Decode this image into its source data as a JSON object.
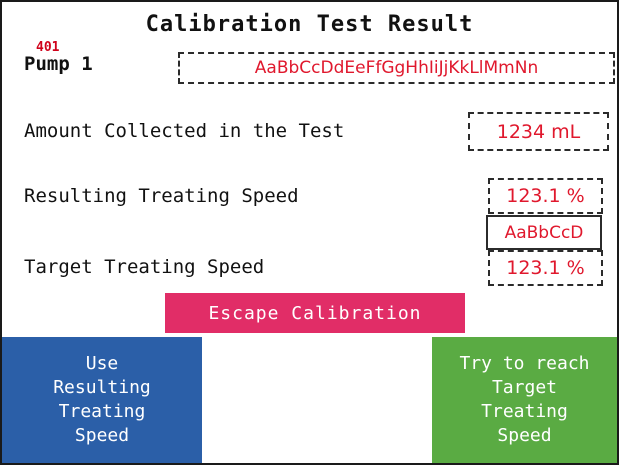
{
  "screen": {
    "title": "Calibration Test Result",
    "screen_id": "401"
  },
  "pump": {
    "label": "Pump 1",
    "name_value": "AaBbCcDdEeFfGgHhIiJjKkLlMmNn"
  },
  "amount": {
    "label": "Amount Collected in the Test",
    "value": "1234 mL"
  },
  "resulting_speed": {
    "label": "Resulting Treating Speed",
    "value": "123.1 %",
    "sub_value": "AaBbCcD"
  },
  "target_speed": {
    "label": "Target Treating Speed",
    "value": "123.1 %"
  },
  "buttons": {
    "escape_label": "Escape Calibration",
    "use_label": "Use\nResulting\nTreating\nSpeed",
    "try_label": "Try to reach\nTarget\nTreating\nSpeed"
  },
  "colors": {
    "value_text": "#e0182d",
    "escape_button": "#e12d67",
    "use_button": "#2b5fa8",
    "try_button": "#5aab43"
  }
}
